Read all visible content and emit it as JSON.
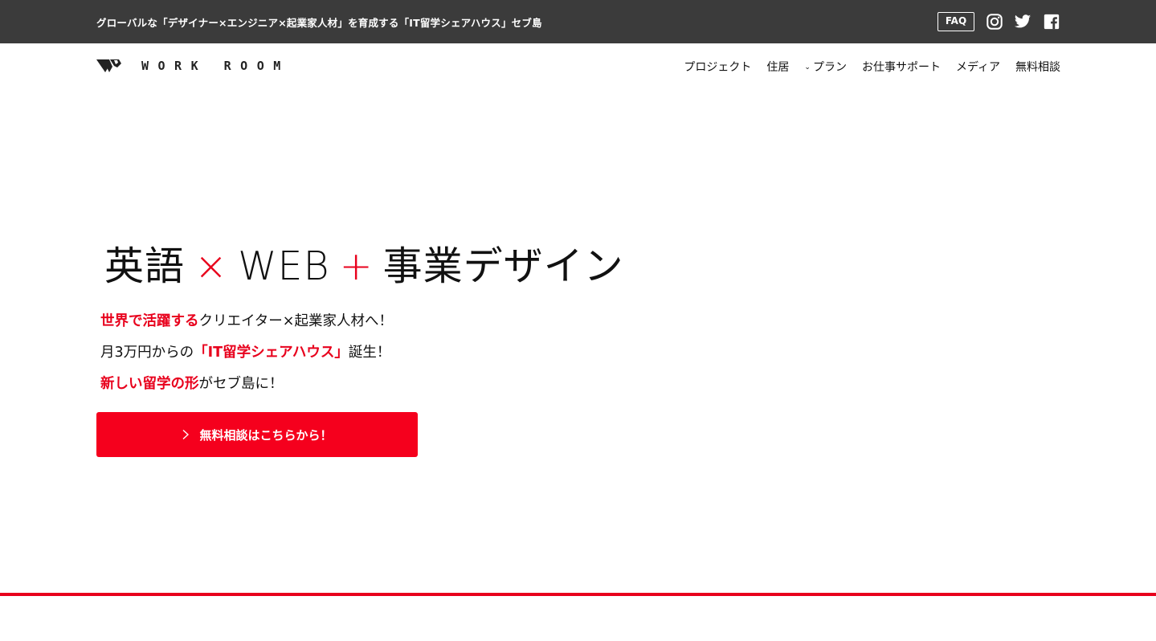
{
  "topbar": {
    "tagline": "グローバルな「デザイナー×エンジニア×起業家人材」を育成する「IT留学シェアハウス」セブ島",
    "faq_label": "FAQ",
    "social_icons": [
      "instagram-icon",
      "twitter-icon",
      "facebook-icon"
    ]
  },
  "navbar": {
    "logo_text": "WORK ROOM",
    "menu": [
      {
        "label": "プロジェクト"
      },
      {
        "label": "住居"
      },
      {
        "label": "プラン",
        "icon": "chevron-down-icon"
      },
      {
        "label": "お仕事サポート"
      },
      {
        "label": "メディア"
      },
      {
        "label": "無料相談"
      }
    ]
  },
  "hero": {
    "title_part1": "英語",
    "title_times": "×",
    "title_part2": "WEB",
    "title_plus": "+",
    "title_part3": "事業デザイン",
    "line1_highlight": "世界で活躍する",
    "line1_rest": "クリエイター×起業家人材へ！",
    "line2_pre": "月3万円からの",
    "line2_highlight": "「IT留学シェアハウス」",
    "line2_post": "誕生！",
    "line3_highlight": "新しい留学の形",
    "line3_rest": "がセブ島に！",
    "cta_label": "無料相談はこちらから！"
  },
  "colors": {
    "topbar_bg": "#3b3b3b",
    "accent_red": "#e8001c",
    "cta_bg": "#f5001d"
  }
}
